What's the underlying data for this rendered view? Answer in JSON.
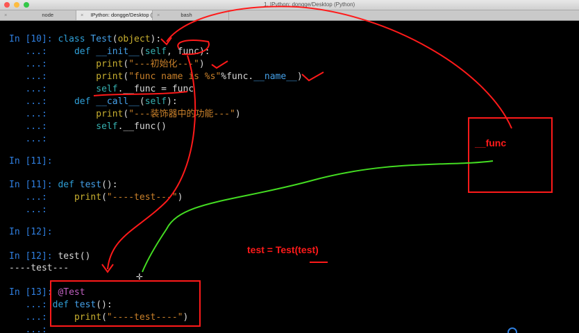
{
  "window": {
    "title": "1. IPython: dongge/Desktop (Python)"
  },
  "tabs": [
    {
      "label": "node",
      "active": false
    },
    {
      "label": "IPython: dongge/Desktop (P...",
      "active": true
    },
    {
      "label": "bash",
      "active": false
    }
  ],
  "lines": {
    "l1_prompt": "In [10]:",
    "l1_kw": "class",
    "l1_name": "Test",
    "l1_paren_open": "(",
    "l1_base": "object",
    "l1_rest": "):",
    "l2_prompt": "   ...:",
    "l2_kw": "def",
    "l2_name": "__init__",
    "l2_a": "(",
    "l2_self": "self",
    "l2_b": ", func):",
    "l3_prompt": "   ...:",
    "l3_bi": "print",
    "l3_a": "(",
    "l3_str": "\"---初始化---\"",
    "l3_b": ")",
    "l4_prompt": "   ...:",
    "l4_bi": "print",
    "l4_a": "(",
    "l4_str": "\"func name is %s\"",
    "l4_b": "%func.",
    "l4_attr": "__name__",
    "l4_c": ")",
    "l5_prompt": "   ...:",
    "l5_self": "self",
    "l5_rest": ".__func = func",
    "l6_prompt": "   ...:",
    "l6_kw": "def",
    "l6_name": "__call__",
    "l6_a": "(",
    "l6_self": "self",
    "l6_b": "):",
    "l7_prompt": "   ...:",
    "l7_bi": "print",
    "l7_a": "(",
    "l7_str": "\"---装饰器中的功能---\"",
    "l7_b": ")",
    "l8_prompt": "   ...:",
    "l8_self": "self",
    "l8_rest": ".__func()",
    "l9_prompt": "   ...:",
    "l10_prompt": "In [11]:",
    "l11_prompt": "In [11]:",
    "l11_kw": "def",
    "l11_name": "test",
    "l11_rest": "():",
    "l12_prompt": "   ...:",
    "l12_bi": "print",
    "l12_a": "(",
    "l12_str": "\"----test---\"",
    "l12_b": ")",
    "l13_prompt": "   ...:",
    "l14_prompt": "In [12]:",
    "l15_prompt": "In [12]:",
    "l15_code": "test()",
    "l16_out": "----test---",
    "l17_prompt": "In [13]:",
    "l17_dec": "@Test",
    "l18_prompt": "   ...:",
    "l18_kw": "def",
    "l18_name": "test",
    "l18_rest": "():",
    "l19_prompt": "   ...:",
    "l19_bi": "print",
    "l19_a": "(",
    "l19_str": "\"----test----\"",
    "l19_b": ")",
    "l20_prompt": "   ...:"
  },
  "annotations": {
    "func_label": "__func",
    "assign_label": "test = Test(test)"
  },
  "colors": {
    "annotation_red": "#ff1a1a",
    "annotation_green": "#44dd22",
    "prompt_blue": "#2f7fe0",
    "prompt_num_green": "#4cc94c"
  }
}
